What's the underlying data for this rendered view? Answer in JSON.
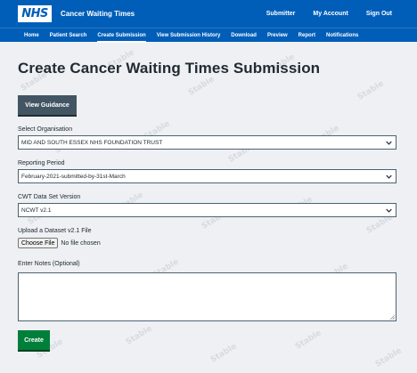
{
  "header": {
    "logo_text": "NHS",
    "app_title": "Cancer Waiting Times",
    "links": {
      "submitter": "Submitter",
      "my_account": "My Account",
      "sign_out": "Sign Out"
    }
  },
  "nav": {
    "items": [
      {
        "label": "Home"
      },
      {
        "label": "Patient Search"
      },
      {
        "label": "Create Submission",
        "active": true
      },
      {
        "label": "View Submission History"
      },
      {
        "label": "Download"
      },
      {
        "label": "Preview"
      },
      {
        "label": "Report"
      },
      {
        "label": "Notifications"
      }
    ]
  },
  "watermark_text": "Stable",
  "main": {
    "title": "Create Cancer Waiting Times Submission",
    "guidance_button": "View Guidance",
    "organisation": {
      "label": "Select Organisation",
      "value": "MID AND SOUTH ESSEX NHS FOUNDATION TRUST"
    },
    "reporting_period": {
      "label": "Reporting Period",
      "value": "February-2021-submitted-by-31st-March"
    },
    "dataset_version": {
      "label": "CWT Data Set Version",
      "value": "NCWT v2.1"
    },
    "upload": {
      "label": "Upload a Dataset v2.1 File",
      "button": "Choose File",
      "status": "No file chosen"
    },
    "notes": {
      "label": "Enter Notes (Optional)",
      "value": ""
    },
    "create_button": "Create"
  },
  "colors": {
    "nhs_blue": "#005eb8",
    "button_grey": "#425563",
    "create_green": "#007f3b",
    "background": "#eef0f3"
  }
}
